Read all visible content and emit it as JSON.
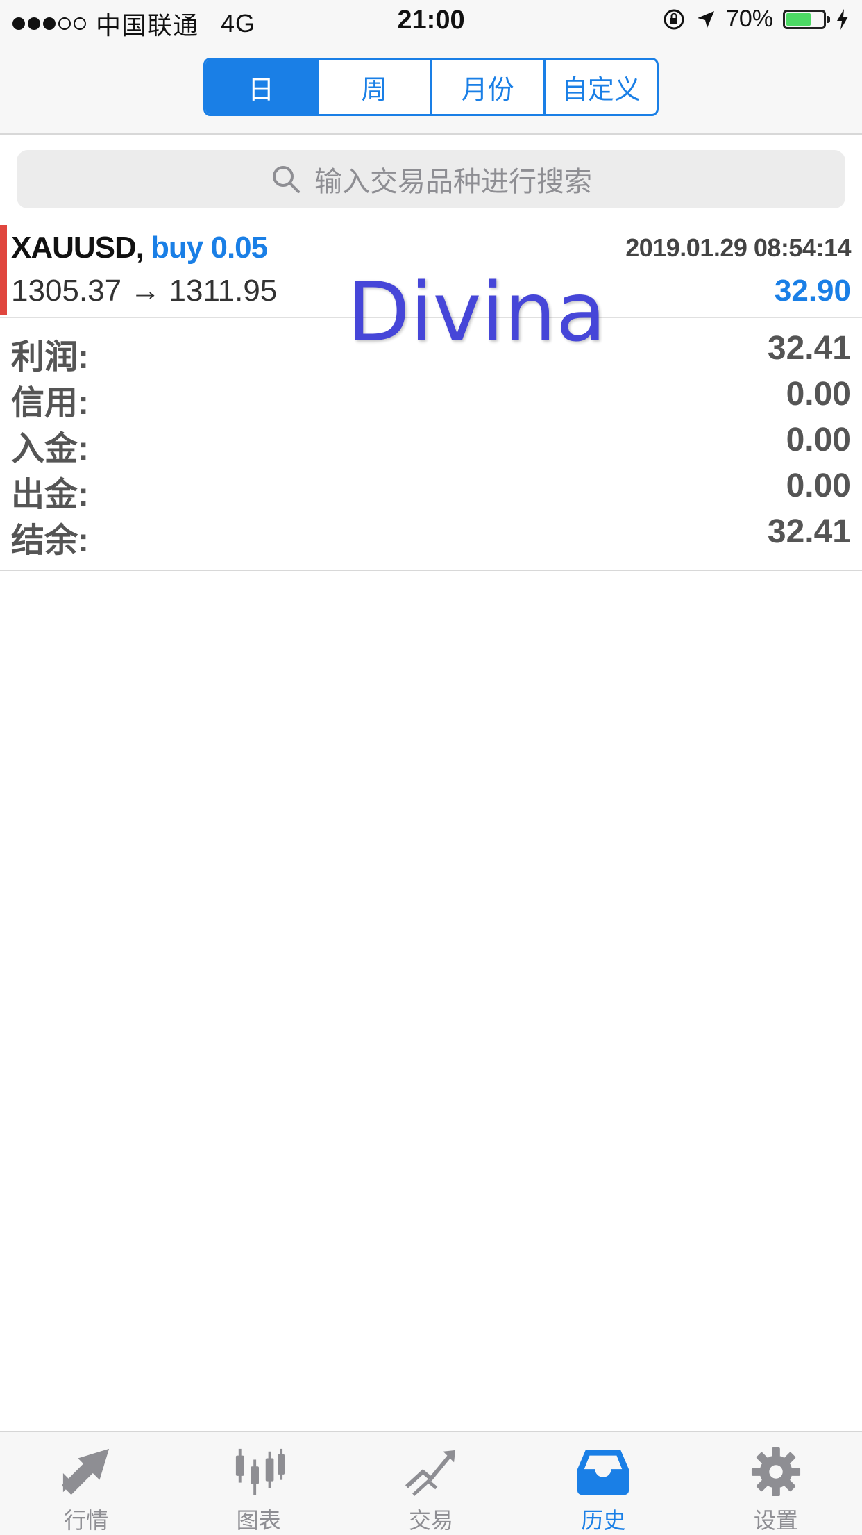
{
  "status_bar": {
    "carrier": "中国联通",
    "network": "4G",
    "time": "21:00",
    "battery_text": "70%",
    "battery_level": 0.7,
    "battery_color": "#4cd964"
  },
  "segments": [
    {
      "label": "日",
      "active": true
    },
    {
      "label": "周",
      "active": false
    },
    {
      "label": "月份",
      "active": false
    },
    {
      "label": "自定义",
      "active": false
    }
  ],
  "search": {
    "placeholder": "输入交易品种进行搜索"
  },
  "trade": {
    "symbol": "XAUUSD,",
    "direction": "buy 0.05",
    "datetime": "2019.01.29 08:54:14",
    "prices": "1305.37 → 1311.95",
    "profit": "32.90"
  },
  "watermark": "Divina",
  "summary": [
    {
      "label": "利润:",
      "value": "32.41"
    },
    {
      "label": "信用:",
      "value": "0.00"
    },
    {
      "label": "入金:",
      "value": "0.00"
    },
    {
      "label": "出金:",
      "value": "0.00"
    },
    {
      "label": "结余:",
      "value": "32.41"
    }
  ],
  "tabs": [
    {
      "label": "行情",
      "icon": "quotes-arrows-icon"
    },
    {
      "label": "图表",
      "icon": "candlestick-chart-icon"
    },
    {
      "label": "交易",
      "icon": "trade-trend-icon"
    },
    {
      "label": "历史",
      "icon": "history-tray-icon",
      "active": true
    },
    {
      "label": "设置",
      "icon": "gear-icon"
    }
  ],
  "colors": {
    "accent": "#1a7fe6",
    "sell_marker": "#e0463e"
  }
}
